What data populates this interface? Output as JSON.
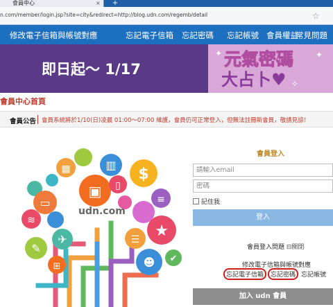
{
  "browser": {
    "tab_title": "會員中心",
    "tab_close": "×",
    "new_tab": "+",
    "url": "n.com/member/login.jsp?site=city&redirect=http://blog.udn.com/regemb/detail"
  },
  "nav": {
    "items": [
      "修改電子信箱與帳號對應",
      "忘記電子信箱",
      "忘記密碼",
      "忘記帳號",
      "會員權益",
      "常見問題"
    ]
  },
  "banner": {
    "headline": "即日起～ 1/17",
    "title_line1": "元氣密碼",
    "title_line2": "大占卜♥"
  },
  "page": {
    "title": "會員中心首頁",
    "notice_label": "會員公告",
    "notice_text": "會員系統將於1/10(日)凌晨 01:00～07:00 維護，會員仍可正常登入，但無法註冊新會員，敬請見諒！"
  },
  "illustration": {
    "brand": "udn.com"
  },
  "login": {
    "title": "會員登入",
    "email_placeholder": "請輸入email",
    "email_value": "",
    "password_placeholder": "密碼",
    "password_value": "",
    "remember_label": "記住我",
    "login_button": "登入",
    "help_text": "會員登入問題",
    "help_close": "⊟關閉",
    "forgot_mapping": "修改電子信箱與帳號對應",
    "forgot_email": "忘記電子信箱",
    "forgot_password": "忘記密碼",
    "forgot_account": "忘記帳號",
    "join_button": "加入 udn 會員"
  },
  "colors": {
    "nav_bg": "#1d6fc0",
    "accent_red": "#c0392b",
    "login_button": "#8ab8e4",
    "join_button": "#8e8e8e",
    "annotation_circle": "#d21c1c"
  }
}
